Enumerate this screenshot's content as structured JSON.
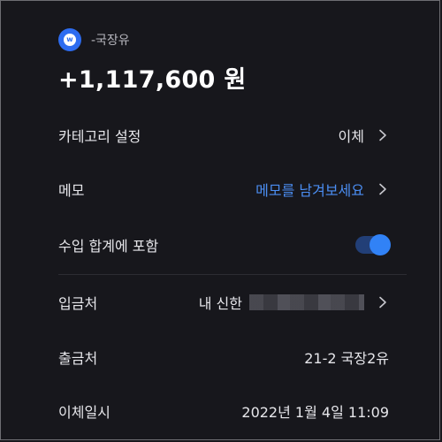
{
  "header": {
    "bank_logo_icon": "bank-logo-icon",
    "name": "-국장유"
  },
  "amount": "+1,117,600 원",
  "rows": {
    "category": {
      "label": "카테고리 설정",
      "value": "이체"
    },
    "memo": {
      "label": "메모",
      "value": "메모를 남겨보세요"
    },
    "include_income": {
      "label": "수입 합계에 포함",
      "toggle_on": true
    },
    "deposit_to": {
      "label": "입금처",
      "value": "내 신한"
    },
    "withdraw_from": {
      "label": "출금처",
      "value": "21-2 국장2유"
    },
    "transfer_datetime": {
      "label": "이체일시",
      "value": "2022년 1월 4일 11:09"
    }
  },
  "colors": {
    "background": "#17171c",
    "accent": "#3182f6",
    "link": "#4b8ef3"
  }
}
